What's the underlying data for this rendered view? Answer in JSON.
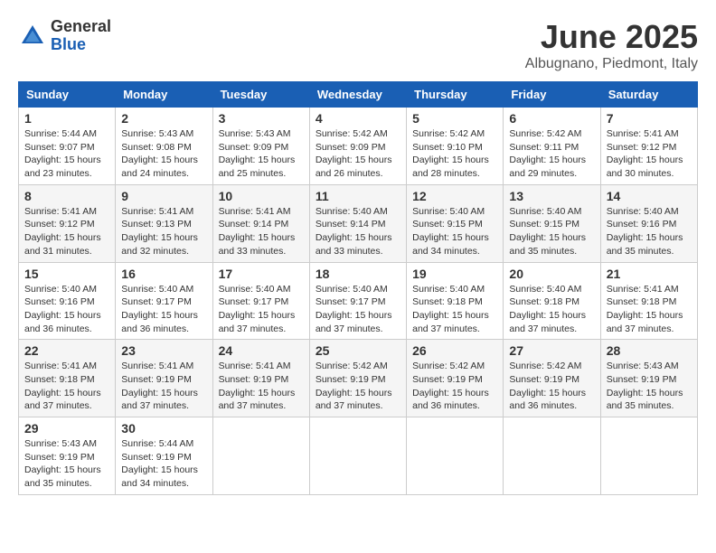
{
  "header": {
    "logo_general": "General",
    "logo_blue": "Blue",
    "title": "June 2025",
    "location": "Albugnano, Piedmont, Italy"
  },
  "weekdays": [
    "Sunday",
    "Monday",
    "Tuesday",
    "Wednesday",
    "Thursday",
    "Friday",
    "Saturday"
  ],
  "weeks": [
    [
      {
        "day": "1",
        "info": "Sunrise: 5:44 AM\nSunset: 9:07 PM\nDaylight: 15 hours\nand 23 minutes."
      },
      {
        "day": "2",
        "info": "Sunrise: 5:43 AM\nSunset: 9:08 PM\nDaylight: 15 hours\nand 24 minutes."
      },
      {
        "day": "3",
        "info": "Sunrise: 5:43 AM\nSunset: 9:09 PM\nDaylight: 15 hours\nand 25 minutes."
      },
      {
        "day": "4",
        "info": "Sunrise: 5:42 AM\nSunset: 9:09 PM\nDaylight: 15 hours\nand 26 minutes."
      },
      {
        "day": "5",
        "info": "Sunrise: 5:42 AM\nSunset: 9:10 PM\nDaylight: 15 hours\nand 28 minutes."
      },
      {
        "day": "6",
        "info": "Sunrise: 5:42 AM\nSunset: 9:11 PM\nDaylight: 15 hours\nand 29 minutes."
      },
      {
        "day": "7",
        "info": "Sunrise: 5:41 AM\nSunset: 9:12 PM\nDaylight: 15 hours\nand 30 minutes."
      }
    ],
    [
      {
        "day": "8",
        "info": "Sunrise: 5:41 AM\nSunset: 9:12 PM\nDaylight: 15 hours\nand 31 minutes."
      },
      {
        "day": "9",
        "info": "Sunrise: 5:41 AM\nSunset: 9:13 PM\nDaylight: 15 hours\nand 32 minutes."
      },
      {
        "day": "10",
        "info": "Sunrise: 5:41 AM\nSunset: 9:14 PM\nDaylight: 15 hours\nand 33 minutes."
      },
      {
        "day": "11",
        "info": "Sunrise: 5:40 AM\nSunset: 9:14 PM\nDaylight: 15 hours\nand 33 minutes."
      },
      {
        "day": "12",
        "info": "Sunrise: 5:40 AM\nSunset: 9:15 PM\nDaylight: 15 hours\nand 34 minutes."
      },
      {
        "day": "13",
        "info": "Sunrise: 5:40 AM\nSunset: 9:15 PM\nDaylight: 15 hours\nand 35 minutes."
      },
      {
        "day": "14",
        "info": "Sunrise: 5:40 AM\nSunset: 9:16 PM\nDaylight: 15 hours\nand 35 minutes."
      }
    ],
    [
      {
        "day": "15",
        "info": "Sunrise: 5:40 AM\nSunset: 9:16 PM\nDaylight: 15 hours\nand 36 minutes."
      },
      {
        "day": "16",
        "info": "Sunrise: 5:40 AM\nSunset: 9:17 PM\nDaylight: 15 hours\nand 36 minutes."
      },
      {
        "day": "17",
        "info": "Sunrise: 5:40 AM\nSunset: 9:17 PM\nDaylight: 15 hours\nand 37 minutes."
      },
      {
        "day": "18",
        "info": "Sunrise: 5:40 AM\nSunset: 9:17 PM\nDaylight: 15 hours\nand 37 minutes."
      },
      {
        "day": "19",
        "info": "Sunrise: 5:40 AM\nSunset: 9:18 PM\nDaylight: 15 hours\nand 37 minutes."
      },
      {
        "day": "20",
        "info": "Sunrise: 5:40 AM\nSunset: 9:18 PM\nDaylight: 15 hours\nand 37 minutes."
      },
      {
        "day": "21",
        "info": "Sunrise: 5:41 AM\nSunset: 9:18 PM\nDaylight: 15 hours\nand 37 minutes."
      }
    ],
    [
      {
        "day": "22",
        "info": "Sunrise: 5:41 AM\nSunset: 9:18 PM\nDaylight: 15 hours\nand 37 minutes."
      },
      {
        "day": "23",
        "info": "Sunrise: 5:41 AM\nSunset: 9:19 PM\nDaylight: 15 hours\nand 37 minutes."
      },
      {
        "day": "24",
        "info": "Sunrise: 5:41 AM\nSunset: 9:19 PM\nDaylight: 15 hours\nand 37 minutes."
      },
      {
        "day": "25",
        "info": "Sunrise: 5:42 AM\nSunset: 9:19 PM\nDaylight: 15 hours\nand 37 minutes."
      },
      {
        "day": "26",
        "info": "Sunrise: 5:42 AM\nSunset: 9:19 PM\nDaylight: 15 hours\nand 36 minutes."
      },
      {
        "day": "27",
        "info": "Sunrise: 5:42 AM\nSunset: 9:19 PM\nDaylight: 15 hours\nand 36 minutes."
      },
      {
        "day": "28",
        "info": "Sunrise: 5:43 AM\nSunset: 9:19 PM\nDaylight: 15 hours\nand 35 minutes."
      }
    ],
    [
      {
        "day": "29",
        "info": "Sunrise: 5:43 AM\nSunset: 9:19 PM\nDaylight: 15 hours\nand 35 minutes."
      },
      {
        "day": "30",
        "info": "Sunrise: 5:44 AM\nSunset: 9:19 PM\nDaylight: 15 hours\nand 34 minutes."
      },
      {
        "day": "",
        "info": ""
      },
      {
        "day": "",
        "info": ""
      },
      {
        "day": "",
        "info": ""
      },
      {
        "day": "",
        "info": ""
      },
      {
        "day": "",
        "info": ""
      }
    ]
  ]
}
